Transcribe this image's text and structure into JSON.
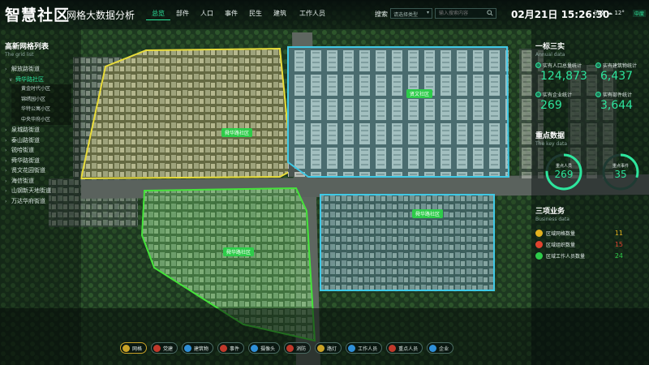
{
  "header": {
    "brand": "智慧社区",
    "subtitle": "网格大数据分析",
    "nav": [
      "总览",
      "部件",
      "人口",
      "事件",
      "民生",
      "建筑",
      "工作人员"
    ],
    "search_label": "搜索",
    "select_placeholder": "请选择类型",
    "search_placeholder": "输入搜索内容",
    "datetime": "02月21日 15:26:30",
    "weather_city": "济南",
    "weather_temp": "12°",
    "weather_air": "中度"
  },
  "grid_list": {
    "title": "高新网格列表",
    "subtitle": "The grid list",
    "items": [
      {
        "label": "解放路街道",
        "level": 1
      },
      {
        "label": "舜华路社区",
        "level": 2
      },
      {
        "label": "黄金时代小区",
        "level": 3
      },
      {
        "label": "锦绣园小区",
        "level": 3
      },
      {
        "label": "华特公寓小区",
        "level": 3
      },
      {
        "label": "中央华府小区",
        "level": 3
      },
      {
        "label": "泉城路街道",
        "level": 1
      },
      {
        "label": "泰山路街道",
        "level": 1
      },
      {
        "label": "锐哈街道",
        "level": 1
      },
      {
        "label": "舜华路街道",
        "level": 1
      },
      {
        "label": "贤文花园街道",
        "level": 1
      },
      {
        "label": "海信街道",
        "level": 1
      },
      {
        "label": "山钢新天地街道",
        "level": 1
      },
      {
        "label": "万达华府街道",
        "level": 1
      }
    ]
  },
  "right": {
    "annual": {
      "title": "一标三实",
      "subtitle": "Annual data",
      "stats": [
        {
          "label": "实有人口总量统计",
          "value": "124,873"
        },
        {
          "label": "实有建筑物统计",
          "value": "6,437"
        },
        {
          "label": "实有企业统计",
          "value": "269"
        },
        {
          "label": "实有部件统计",
          "value": "3,644"
        }
      ]
    },
    "key": {
      "title": "重点数据",
      "subtitle": "The key data",
      "rings": [
        {
          "label": "重点人员",
          "value": "269",
          "color": "#2ee59d"
        },
        {
          "label": "重点事件",
          "value": "35",
          "color": "#2ee59d"
        }
      ]
    },
    "business": {
      "title": "三项业务",
      "subtitle": "Business data",
      "rows": [
        {
          "label": "区域网格数量",
          "value": "11",
          "color": "#e3b21f"
        },
        {
          "label": "区域组织数量",
          "value": "15",
          "color": "#e0432f"
        },
        {
          "label": "区域工作人员数量",
          "value": "24",
          "color": "#2ecc4a"
        }
      ]
    }
  },
  "map": {
    "communities": [
      "舜华路社区",
      "贤文社区",
      "舜华路社区",
      "舜华路社区"
    ]
  },
  "toolbar": {
    "buttons": [
      {
        "label": "网格",
        "color": "#c9a227"
      },
      {
        "label": "党建",
        "color": "#c0392b"
      },
      {
        "label": "建筑物",
        "color": "#2f8fd8"
      },
      {
        "label": "事件",
        "color": "#c0392b"
      },
      {
        "label": "摄像头",
        "color": "#2f8fd8"
      },
      {
        "label": "消防",
        "color": "#c0392b"
      },
      {
        "label": "路灯",
        "color": "#c9a227"
      },
      {
        "label": "工作人员",
        "color": "#2f8fd8"
      },
      {
        "label": "重点人员",
        "color": "#c0392b"
      },
      {
        "label": "企业",
        "color": "#2f8fd8"
      }
    ]
  }
}
